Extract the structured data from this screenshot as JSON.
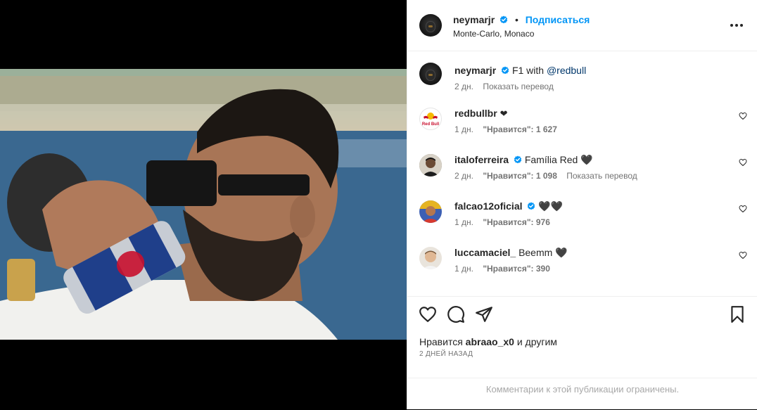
{
  "post": {
    "author": "neymarjr",
    "follow_label": "Подписаться",
    "separator": "•",
    "location": "Monte-Carlo, Monaco"
  },
  "caption": {
    "username": "neymarjr",
    "text_prefix": "F1 with ",
    "mention": "@redbull",
    "time": "2 дн.",
    "translate": "Показать перевод"
  },
  "comments": [
    {
      "username": "redbullbr",
      "text": "❤",
      "time": "1 дн.",
      "likes": "\"Нравится\": 1 627",
      "translate": ""
    },
    {
      "username": "italoferreira",
      "text": "Família Red 🖤",
      "time": "2 дн.",
      "likes": "\"Нравится\": 1 098",
      "translate": "Показать перевод"
    },
    {
      "username": "falcao12oficial",
      "text": "🖤🖤",
      "time": "1 дн.",
      "likes": "\"Нравится\": 976",
      "translate": ""
    },
    {
      "username": "luccamaciel_",
      "text": "Beemm 🖤",
      "time": "1 дн.",
      "likes": "\"Нравится\": 390",
      "translate": ""
    }
  ],
  "likes": {
    "prefix": "Нравится",
    "user": "abraao_x0",
    "suffix": "и другим"
  },
  "date": "2 ДНЕЙ НАЗАД",
  "restricted_notice": "Комментарии к этой публикации ограничены.",
  "icons": {
    "verified": "verified-badge-icon",
    "more": "more-options-icon",
    "like": "heart-icon",
    "comment": "comment-icon",
    "share": "send-icon",
    "save": "bookmark-icon"
  },
  "colors": {
    "accent": "#0095f6",
    "verified": "#0095f6",
    "text": "#262626",
    "muted": "#737373"
  }
}
